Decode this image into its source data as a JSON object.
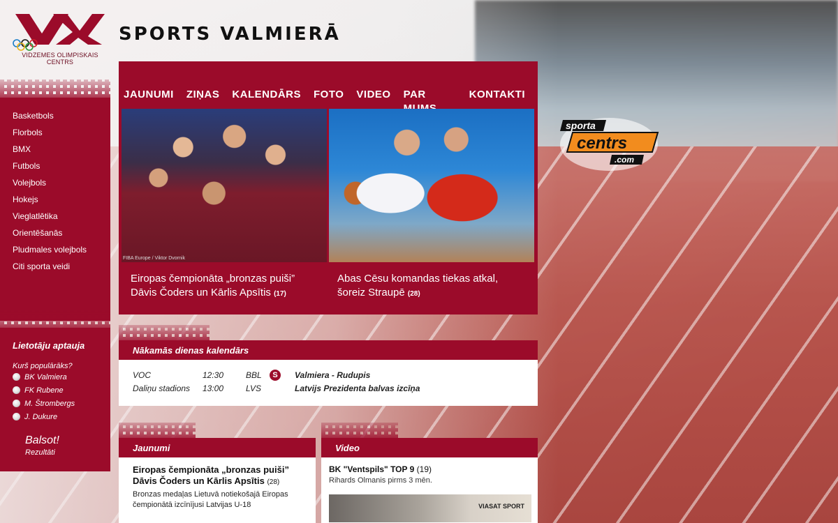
{
  "header": {
    "site_title": "SPORTS VALMIERĀ",
    "logo_subtitle": "VIDZEMES OLIMPISKAIS CENTRS"
  },
  "nav": [
    "JAUNUMI",
    "ZIŅAS",
    "KALENDĀRS",
    "FOTO",
    "VIDEO",
    "PAR MUMS",
    "KONTAKTI"
  ],
  "sidebar": {
    "items": [
      "Basketbols",
      "Florbols",
      "BMX",
      "Futbols",
      "Volejbols",
      "Hokejs",
      "Vieglatlētika",
      "Orientēšanās",
      "Pludmales volejbols",
      "Citi sporta veidi"
    ]
  },
  "poll": {
    "title": "Lietotāju aptauja",
    "question": "Kurš populārāks?",
    "options": [
      "BK Valmiera",
      "FK Rubene",
      "M. Štrombergs",
      "J. Dukure"
    ],
    "vote_label": "Balsot!",
    "results_label": "Rezultāti"
  },
  "hero": [
    {
      "caption": "Eiropas čempionāta „bronzas puiši” Dāvis Čoders un Kārlis Apsītis",
      "count": "(17)",
      "credit": "FIBA Europe / Viktor Dvornik"
    },
    {
      "caption": "Abas Cēsu komandas tiekas atkal, šoreiz Straupē",
      "count": "(28)"
    }
  ],
  "partner": {
    "top": "sporta",
    "main": "centrs",
    "sub": ".com"
  },
  "calendar": {
    "title": "Nākamās dienas kalendārs",
    "rows": [
      {
        "place": "VOC",
        "time": "12:30",
        "league": "BBL",
        "match": "Valmiera - Rudupis"
      },
      {
        "place": "Daliņu stadions",
        "time": "13:00",
        "league": "LVS",
        "match": "Latvijs Prezidenta balvas izcīņa"
      }
    ],
    "icon": "S"
  },
  "news": {
    "title": "Jaunumi",
    "item_title": "Eiropas čempionāta „bronzas puiši” Dāvis Čoders un Kārlis Apsītis",
    "item_count": "(28)",
    "item_text": "Bronzas medaļas Lietuvā notiekošajā Eiropas čempionātā izcīnījusi Latvijas U-18"
  },
  "video": {
    "title": "Video",
    "item_title": "BK \"Ventspils\" TOP 9",
    "item_count": "(19)",
    "item_sub": "Rihards Olmanis pirms 3 mēn.",
    "thumb_logo": "VIASAT SPORT"
  },
  "colors": {
    "accent": "#9b0b2a",
    "partner_orange": "#f28c1e"
  }
}
